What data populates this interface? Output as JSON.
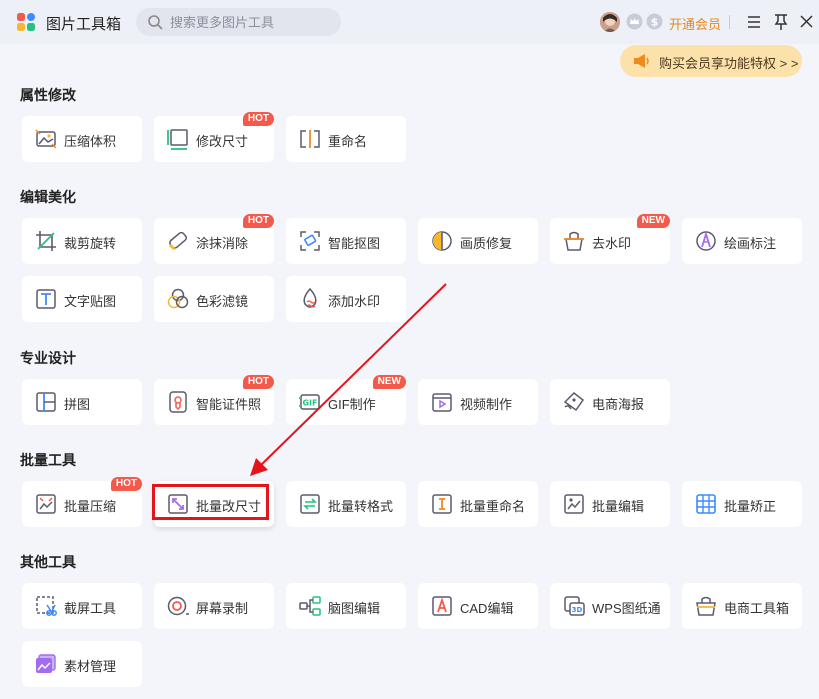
{
  "app": {
    "title": "图片工具箱"
  },
  "search": {
    "placeholder": "搜索更多图片工具"
  },
  "header": {
    "vip_label": "开通会员"
  },
  "promo": {
    "label": "购买会员享功能特权 > >"
  },
  "colors": {
    "accent": "#e48a1a",
    "badge": "#f45a4b",
    "highlight": "#e5141b",
    "icon": "#5a5a6e"
  },
  "sections": [
    {
      "title": "属性修改",
      "items": [
        {
          "label": "压缩体积",
          "icon": "compress-icon"
        },
        {
          "label": "修改尺寸",
          "icon": "resize-icon",
          "badge": "HOT"
        },
        {
          "label": "重命名",
          "icon": "rename-icon"
        }
      ]
    },
    {
      "title": "编辑美化",
      "items": [
        {
          "label": "裁剪旋转",
          "icon": "crop-icon"
        },
        {
          "label": "涂抹消除",
          "icon": "eraser-icon",
          "badge": "HOT"
        },
        {
          "label": "智能抠图",
          "icon": "cutout-icon"
        },
        {
          "label": "画质修复",
          "icon": "quality-icon"
        },
        {
          "label": "去水印",
          "icon": "watermark-remove-icon",
          "badge": "NEW"
        },
        {
          "label": "绘画标注",
          "icon": "annotate-icon"
        },
        {
          "label": "文字贴图",
          "icon": "text-icon"
        },
        {
          "label": "色彩滤镜",
          "icon": "filter-icon"
        },
        {
          "label": "添加水印",
          "icon": "add-watermark-icon"
        }
      ]
    },
    {
      "title": "专业设计",
      "items": [
        {
          "label": "拼图",
          "icon": "collage-icon"
        },
        {
          "label": "智能证件照",
          "icon": "id-photo-icon",
          "badge": "HOT"
        },
        {
          "label": "GIF制作",
          "icon": "gif-icon",
          "badge": "NEW"
        },
        {
          "label": "视频制作",
          "icon": "video-icon"
        },
        {
          "label": "电商海报",
          "icon": "poster-icon"
        }
      ]
    },
    {
      "title": "批量工具",
      "items": [
        {
          "label": "批量压缩",
          "icon": "batch-compress-icon",
          "badge": "HOT"
        },
        {
          "label": "批量改尺寸",
          "icon": "batch-resize-icon"
        },
        {
          "label": "批量转格式",
          "icon": "batch-convert-icon"
        },
        {
          "label": "批量重命名",
          "icon": "batch-rename-icon"
        },
        {
          "label": "批量编辑",
          "icon": "batch-edit-icon"
        },
        {
          "label": "批量矫正",
          "icon": "batch-correct-icon"
        }
      ]
    },
    {
      "title": "其他工具",
      "items": [
        {
          "label": "截屏工具",
          "icon": "screenshot-icon"
        },
        {
          "label": "屏幕录制",
          "icon": "record-icon"
        },
        {
          "label": "脑图编辑",
          "icon": "mindmap-icon"
        },
        {
          "label": "CAD编辑",
          "icon": "cad-icon"
        },
        {
          "label": "WPS图纸通",
          "icon": "wps-icon"
        },
        {
          "label": "电商工具箱",
          "icon": "ecommerce-icon"
        },
        {
          "label": "素材管理",
          "icon": "assets-icon"
        }
      ]
    }
  ]
}
